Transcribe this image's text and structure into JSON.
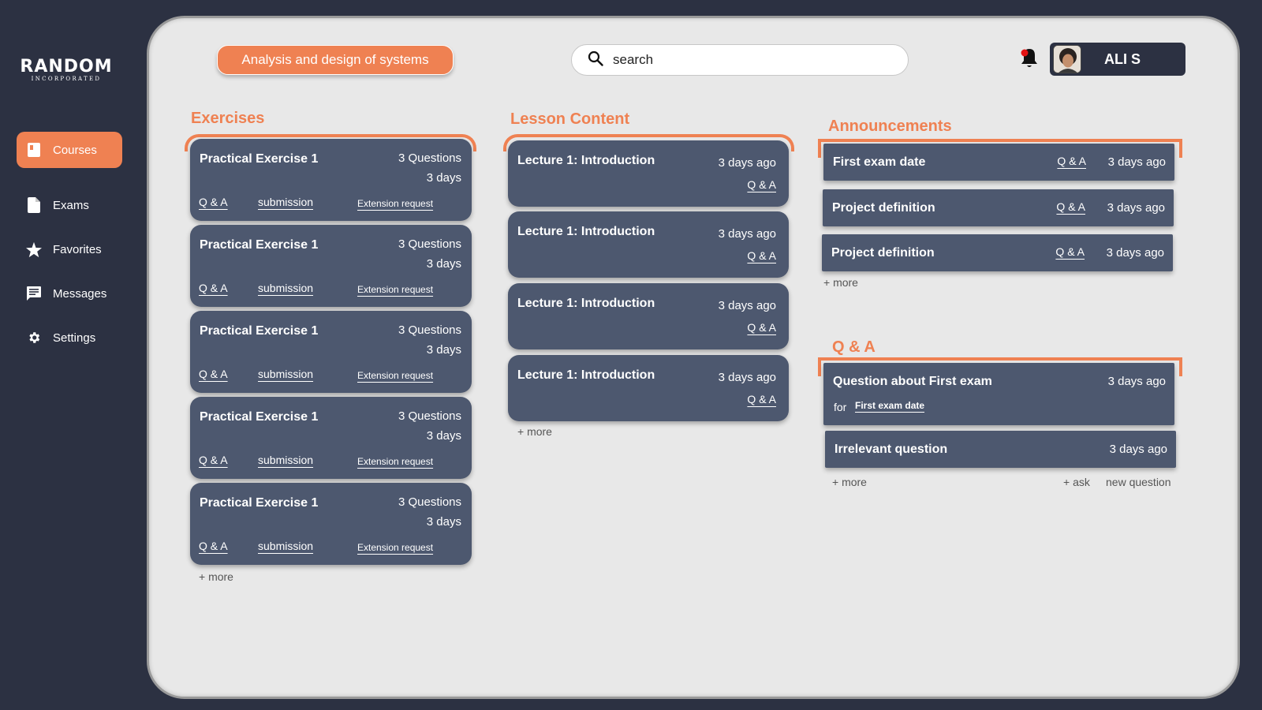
{
  "brand": {
    "name": "RANDOM",
    "tagline": "INCORPORATED"
  },
  "sidebar": {
    "items": [
      {
        "label": "Courses",
        "icon": "book-icon",
        "active": true
      },
      {
        "label": "Exams",
        "icon": "document-icon"
      },
      {
        "label": "Favorites",
        "icon": "star-icon"
      },
      {
        "label": "Messages",
        "icon": "message-icon"
      },
      {
        "label": "Settings",
        "icon": "gear-icon"
      }
    ]
  },
  "header": {
    "course": "Analysis and design of systems",
    "search_placeholder": "search",
    "user_name": "ALI S"
  },
  "exercises": {
    "title": "Exercises",
    "items": [
      {
        "title": "Practical Exercise 1",
        "questions": "3 Questions",
        "days": "3 days",
        "qa": "Q & A",
        "submission": "submission",
        "extension": "Extension request"
      },
      {
        "title": "Practical Exercise 1",
        "questions": "3 Questions",
        "days": "3 days",
        "qa": "Q & A",
        "submission": "submission",
        "extension": "Extension request"
      },
      {
        "title": "Practical Exercise 1",
        "questions": "3 Questions",
        "days": "3 days",
        "qa": "Q & A",
        "submission": "submission",
        "extension": "Extension request"
      },
      {
        "title": "Practical Exercise 1",
        "questions": "3 Questions",
        "days": "3 days",
        "qa": "Q & A",
        "submission": "submission",
        "extension": "Extension request"
      },
      {
        "title": "Practical Exercise 1",
        "questions": "3 Questions",
        "days": "3 days",
        "qa": "Q & A",
        "submission": "submission",
        "extension": "Extension request"
      }
    ],
    "more": "+ more"
  },
  "lessons": {
    "title": "Lesson Content",
    "items": [
      {
        "title": "Lecture 1: Introduction",
        "date": "3 days ago",
        "qa": "Q & A"
      },
      {
        "title": "Lecture 1: Introduction",
        "date": "3 days ago",
        "qa": "Q & A"
      },
      {
        "title": "Lecture 1: Introduction",
        "date": "3 days ago",
        "qa": "Q & A"
      },
      {
        "title": "Lecture 1: Introduction",
        "date": "3 days ago",
        "qa": "Q & A"
      }
    ],
    "more": "+ more"
  },
  "announcements": {
    "title": "Announcements",
    "items": [
      {
        "title": "First exam date",
        "qa": "Q & A",
        "date": "3 days ago"
      },
      {
        "title": "Project definition",
        "qa": "Q & A",
        "date": "3 days ago"
      },
      {
        "title": "Project definition",
        "qa": "Q & A",
        "date": "3 days ago"
      }
    ],
    "more": "+ more"
  },
  "qa": {
    "title": "Q & A",
    "items": [
      {
        "title": "Question about First exam",
        "date": "3 days ago",
        "for_label": "for",
        "for_link": "First exam date"
      },
      {
        "title": "Irrelevant question",
        "date": "3 days ago"
      }
    ],
    "more": "+ more",
    "ask": "+ ask",
    "new_question": "new question"
  },
  "colors": {
    "accent": "#ef8152",
    "card": "#4d586f",
    "background": "#2c3142",
    "panel": "#e8e8e8"
  }
}
